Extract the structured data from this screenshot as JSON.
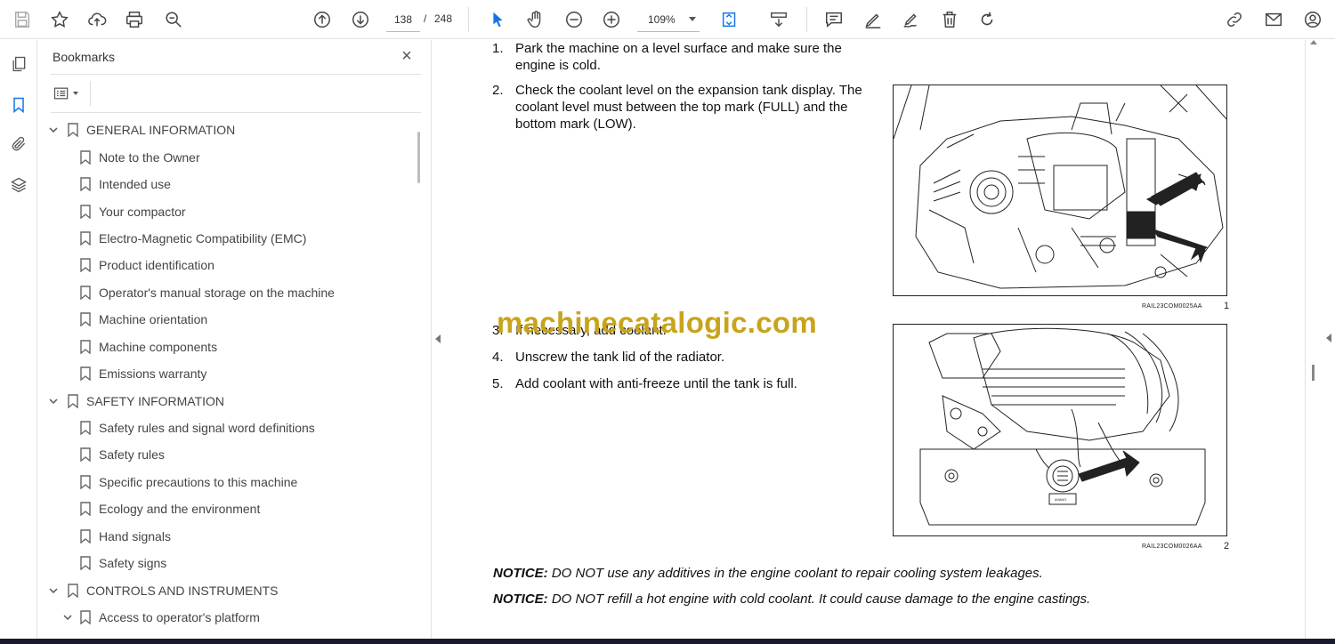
{
  "toolbar": {
    "page_current": "138",
    "page_separator": "/",
    "page_total": "248",
    "zoom": "109%",
    "icons": [
      "save-icon",
      "star-icon",
      "upload-cloud-icon",
      "print-icon",
      "zoom-search-icon",
      "arrow-up-circle-icon",
      "arrow-down-circle-icon",
      "select-cursor-icon",
      "hand-icon",
      "zoom-out-icon",
      "zoom-in-icon",
      "fit-page-icon",
      "scroll-mode-icon",
      "comment-icon",
      "pen-icon",
      "sign-icon",
      "delete-icon",
      "rotate-icon",
      "share-link-icon",
      "mail-icon",
      "account-icon"
    ]
  },
  "left_rail": {
    "icons": [
      "pages-icon",
      "bookmark-icon",
      "attachment-icon",
      "layers-icon"
    ]
  },
  "bookmarks_panel": {
    "title": "Bookmarks",
    "items": [
      {
        "label": "GENERAL INFORMATION",
        "level": 0,
        "expanded": true
      },
      {
        "label": "Note to the Owner",
        "level": 1
      },
      {
        "label": "Intended use",
        "level": 1
      },
      {
        "label": "Your compactor",
        "level": 1
      },
      {
        "label": "Electro-Magnetic Compatibility (EMC)",
        "level": 1
      },
      {
        "label": "Product identification",
        "level": 1
      },
      {
        "label": "Operator's manual storage on the machine",
        "level": 1
      },
      {
        "label": "Machine orientation",
        "level": 1
      },
      {
        "label": "Machine components",
        "level": 1
      },
      {
        "label": "Emissions warranty",
        "level": 1
      },
      {
        "label": "SAFETY INFORMATION",
        "level": 0,
        "expanded": true
      },
      {
        "label": "Safety rules and signal word definitions",
        "level": 1
      },
      {
        "label": "Safety rules",
        "level": 1
      },
      {
        "label": "Specific precautions to this machine",
        "level": 1
      },
      {
        "label": "Ecology and the environment",
        "level": 1
      },
      {
        "label": "Hand signals",
        "level": 1
      },
      {
        "label": "Safety signs",
        "level": 1
      },
      {
        "label": "CONTROLS AND INSTRUMENTS",
        "level": 0,
        "expanded": true
      },
      {
        "label": "Access to operator's platform",
        "level": 2,
        "expanded": true
      }
    ]
  },
  "document": {
    "steps": [
      {
        "num": "1.",
        "text": "Park the machine on a level surface and make sure the engine is cold."
      },
      {
        "num": "2.",
        "text": "Check the coolant level on the expansion tank display. The coolant level must between the top mark (FULL) and the bottom mark (LOW)."
      },
      {
        "num": "3.",
        "text": "If necessary, add coolant."
      },
      {
        "num": "4.",
        "text": "Unscrew the tank lid of the radiator."
      },
      {
        "num": "5.",
        "text": "Add coolant with anti-freeze until the tank is full."
      }
    ],
    "figure1": {
      "caption": "RAIL23COM0025AA",
      "number": "1"
    },
    "figure2": {
      "caption": "RAIL23COM0026AA",
      "number": "2",
      "cap_label": "AVANO"
    },
    "watermark": "machinecatalogic.com",
    "notices": [
      {
        "label": "NOTICE:",
        "text": " DO NOT use any additives in the engine coolant to repair cooling system leakages."
      },
      {
        "label": "NOTICE:",
        "text": " DO NOT refill a hot engine with cold coolant.  It could cause damage to the engine castings."
      }
    ]
  }
}
